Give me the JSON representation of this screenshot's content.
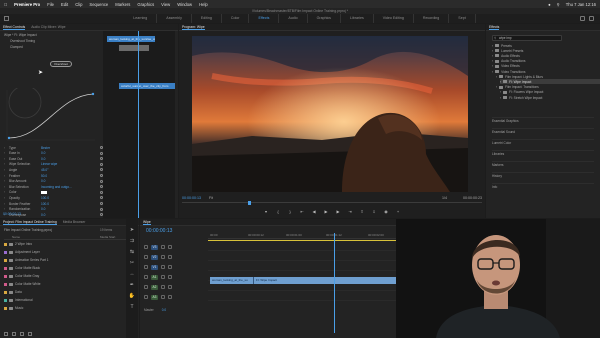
{
  "menubar": {
    "app_name": "Premiere Pro",
    "menus": [
      "File",
      "Edit",
      "Clip",
      "Sequence",
      "Markers",
      "Graphics",
      "View",
      "Window",
      "Help"
    ],
    "clock": "Thu 7 Jan  12:16"
  },
  "title_bar": "/Volumes/Beachmaster/8TB/Film Impact Online Training.prproj *",
  "workspaces": [
    {
      "label": "Learning",
      "active": false
    },
    {
      "label": "Assembly",
      "active": false
    },
    {
      "label": "Editing",
      "active": false
    },
    {
      "label": "Color",
      "active": false
    },
    {
      "label": "Effects",
      "active": true
    },
    {
      "label": "Audio",
      "active": false
    },
    {
      "label": "Graphics",
      "active": false
    },
    {
      "label": "Libraries",
      "active": false
    },
    {
      "label": "Video Editing",
      "active": false
    },
    {
      "label": "Recording",
      "active": false
    },
    {
      "label": "Sept",
      "active": false
    }
  ],
  "effect_controls": {
    "tabs": [
      "Effect Controls",
      "Audio Clip Mixer: Wipe"
    ],
    "clip_a": "woman_looking_at_the_sunrise_over_the_city",
    "clip_b": "colorful_sunset_over_the_city_from",
    "effect_header": "Wipe * FI: Wipe Impact",
    "sub_labels": [
      "Overshoot Timing",
      "Clamped"
    ],
    "tooltip": "Overshoot",
    "params": [
      {
        "label": "Type",
        "value": "Bezier"
      },
      {
        "label": "Ease In",
        "value": "0.0"
      },
      {
        "label": "Ease Out",
        "value": "0.0"
      },
      {
        "label": "Wipe Selection",
        "value": "Linear wipe"
      },
      {
        "label": "Angle",
        "value": "45.0°"
      },
      {
        "label": "Feather",
        "value": "50.0"
      },
      {
        "label": "Blur Amount",
        "value": "0.0"
      },
      {
        "label": "Blur Selection",
        "value": "Incoming and outgo..."
      },
      {
        "label": "Color",
        "value": ""
      },
      {
        "label": "Opacity",
        "value": "100.0"
      },
      {
        "label": "Border Feather",
        "value": "100.0"
      },
      {
        "label": "Randomization",
        "value": "0.0"
      },
      {
        "label": "Overexpose",
        "value": "0.0"
      }
    ],
    "timecode": "00:00:00:13"
  },
  "program": {
    "tab": "Program: Wipe",
    "timecode": "00:00:00:13",
    "fit": "Fit",
    "quality": "1/4",
    "duration": "00:00:00:23",
    "playhead_fraction": 0.22
  },
  "effects_panel": {
    "tab": "Effects",
    "search": "wipe imp",
    "tree": [
      {
        "label": "Presets",
        "indent": 1
      },
      {
        "label": "Lumetri Presets",
        "indent": 1
      },
      {
        "label": "Audio Effects",
        "indent": 1
      },
      {
        "label": "Audio Transitions",
        "indent": 1
      },
      {
        "label": "Video Effects",
        "indent": 1
      },
      {
        "label": "Video Transitions",
        "indent": 1
      },
      {
        "label": "Film Impact: Lights & Blurs",
        "indent": 2
      },
      {
        "label": "FI: Wipe Impact",
        "indent": 3,
        "selected": true
      },
      {
        "label": "Film Impact: Transitions",
        "indent": 2
      },
      {
        "label": "FI: Flowers Wipe Impact",
        "indent": 3
      },
      {
        "label": "FI: Stretch Wipe Impact",
        "indent": 3
      }
    ],
    "sections": [
      "Essential Graphics",
      "Essential Sound",
      "Lumetri Color",
      "Libraries",
      "Markers",
      "History",
      "Info"
    ]
  },
  "project": {
    "tabs": [
      "Project: Film Impact Online Training",
      "Media Browser"
    ],
    "name": "Film Impact Online Training.prproj",
    "count": "19 Items",
    "col_name": "Name",
    "col_rate": "Media Start",
    "items": [
      {
        "name": "2 Wipe Intro",
        "color": "#d8a840"
      },
      {
        "name": "Adjustment Layer",
        "color": "#9a6cd0"
      },
      {
        "name": "Animation Series Part 1",
        "color": "#d8a840"
      },
      {
        "name": "Color Matte Black",
        "color": "#d05a8a"
      },
      {
        "name": "Color Matte Gray",
        "color": "#d05a8a"
      },
      {
        "name": "Color Matte White",
        "color": "#d05a8a"
      },
      {
        "name": "Data",
        "color": "#d8a840"
      },
      {
        "name": "International",
        "color": "#4ab0a0"
      },
      {
        "name": "Music",
        "color": "#d8a840"
      }
    ]
  },
  "timeline": {
    "tab": "Wipe",
    "timecode": "00:00:00:13",
    "ruler": [
      "00:00",
      "00:00:00:12",
      "00:00:01:00",
      "00:00:01:12",
      "00:00:02:00"
    ],
    "tracks": [
      {
        "name": "V3",
        "type": "video"
      },
      {
        "name": "V2",
        "type": "video"
      },
      {
        "name": "V1",
        "type": "video"
      },
      {
        "name": "A1",
        "type": "audio"
      },
      {
        "name": "A2",
        "type": "audio"
      },
      {
        "name": "A3",
        "type": "audio"
      }
    ],
    "clip_a": "woman_looking_at_the_su",
    "clip_b": "FI: Wipe Impact",
    "master_label": "Master",
    "master_value": "0.0"
  },
  "colors": {
    "accent": "#4a9fe8",
    "clip": "#6f9fd0",
    "panel": "#232323"
  }
}
